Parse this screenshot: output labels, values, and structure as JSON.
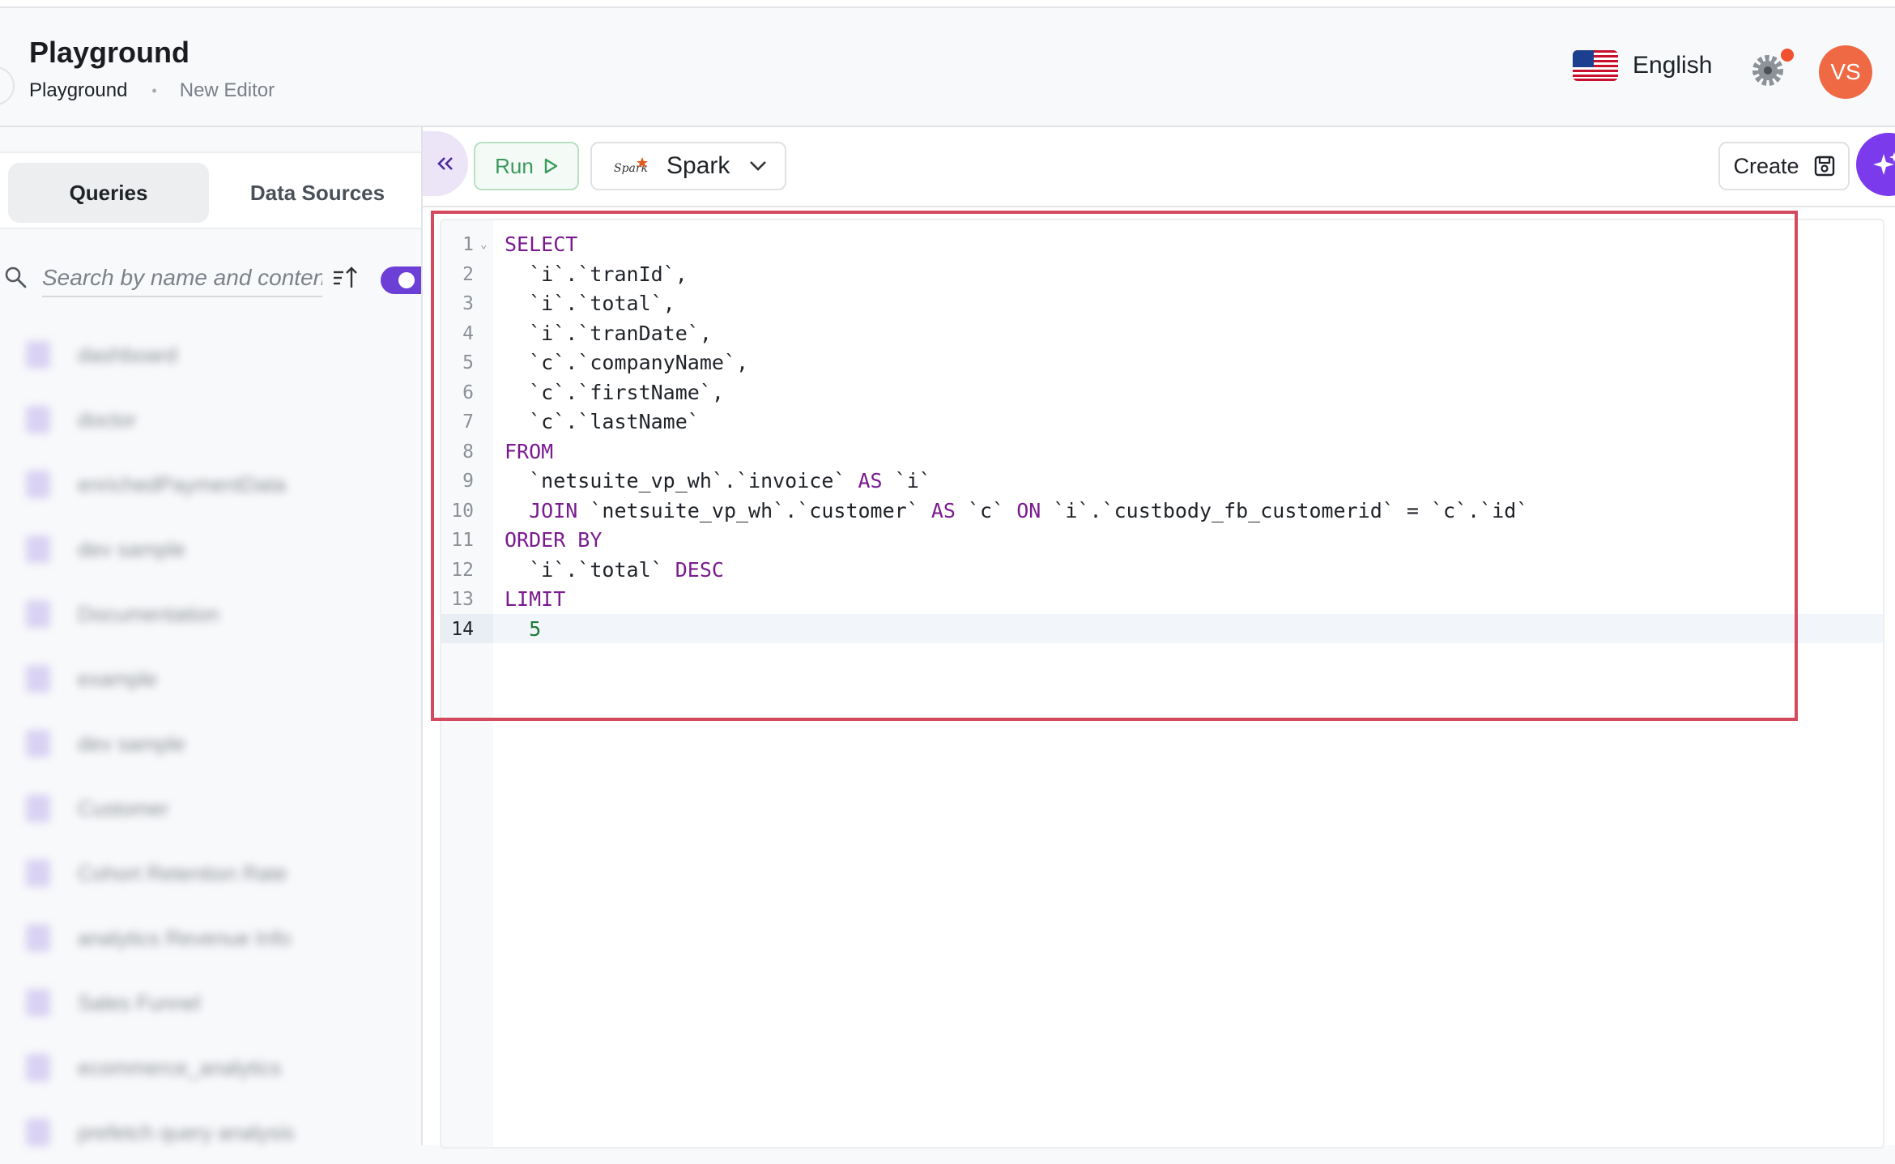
{
  "header": {
    "title": "Playground",
    "breadcrumb": [
      "Playground",
      "New Editor"
    ],
    "language": "English",
    "avatar_initials": "VS",
    "notification_color": "#f0512e",
    "avatar_color": "#ef6a44"
  },
  "sidebar": {
    "tabs": [
      {
        "label": "Queries",
        "active": true
      },
      {
        "label": "Data Sources",
        "active": false
      }
    ],
    "search_placeholder": "Search by name and content",
    "toggle_on": true,
    "queries_blurred": [
      "dashboard",
      "doctor",
      "enrichedPaymentData",
      "dev sample",
      "Documentation",
      "example",
      "dev sample",
      "Customer",
      "Cohort Retention Rate",
      "analytics Revenue Info",
      "Sales Funnel",
      "ecommerce_analytics",
      "prefetch query analysis"
    ]
  },
  "toolbar": {
    "run_label": "Run",
    "engine_label": "Spark",
    "create_label": "Create",
    "accent_color": "#7c3aed"
  },
  "editor": {
    "active_line": 14,
    "lines": [
      {
        "n": "1",
        "text": [
          {
            "t": "SELECT",
            "k": "kw"
          }
        ]
      },
      {
        "n": "2",
        "text": [
          {
            "t": "  `i`.`tranId`,",
            "k": ""
          }
        ]
      },
      {
        "n": "3",
        "text": [
          {
            "t": "  `i`.`total`,",
            "k": ""
          }
        ]
      },
      {
        "n": "4",
        "text": [
          {
            "t": "  `i`.`tranDate`,",
            "k": ""
          }
        ]
      },
      {
        "n": "5",
        "text": [
          {
            "t": "  `c`.`companyName`,",
            "k": ""
          }
        ]
      },
      {
        "n": "6",
        "text": [
          {
            "t": "  `c`.`firstName`,",
            "k": ""
          }
        ]
      },
      {
        "n": "7",
        "text": [
          {
            "t": "  `c`.`lastName`",
            "k": ""
          }
        ]
      },
      {
        "n": "8",
        "text": [
          {
            "t": "FROM",
            "k": "kw"
          }
        ]
      },
      {
        "n": "9",
        "text": [
          {
            "t": "  `netsuite_vp_wh`.`invoice` ",
            "k": ""
          },
          {
            "t": "AS",
            "k": "kw"
          },
          {
            "t": " `i`",
            "k": ""
          }
        ]
      },
      {
        "n": "10",
        "text": [
          {
            "t": "  ",
            "k": ""
          },
          {
            "t": "JOIN",
            "k": "kw"
          },
          {
            "t": " `netsuite_vp_wh`.`customer` ",
            "k": ""
          },
          {
            "t": "AS",
            "k": "kw"
          },
          {
            "t": " `c` ",
            "k": ""
          },
          {
            "t": "ON",
            "k": "kw"
          },
          {
            "t": " `i`.`custbody_fb_customerid` = `c`.`id`",
            "k": ""
          }
        ]
      },
      {
        "n": "11",
        "text": [
          {
            "t": "ORDER BY",
            "k": "kw"
          }
        ]
      },
      {
        "n": "12",
        "text": [
          {
            "t": "  `i`.`total` ",
            "k": ""
          },
          {
            "t": "DESC",
            "k": "kw"
          }
        ]
      },
      {
        "n": "13",
        "text": [
          {
            "t": "LIMIT",
            "k": "kw"
          }
        ]
      },
      {
        "n": "14",
        "text": [
          {
            "t": "  ",
            "k": ""
          },
          {
            "t": "5",
            "k": "num"
          }
        ]
      }
    ]
  }
}
